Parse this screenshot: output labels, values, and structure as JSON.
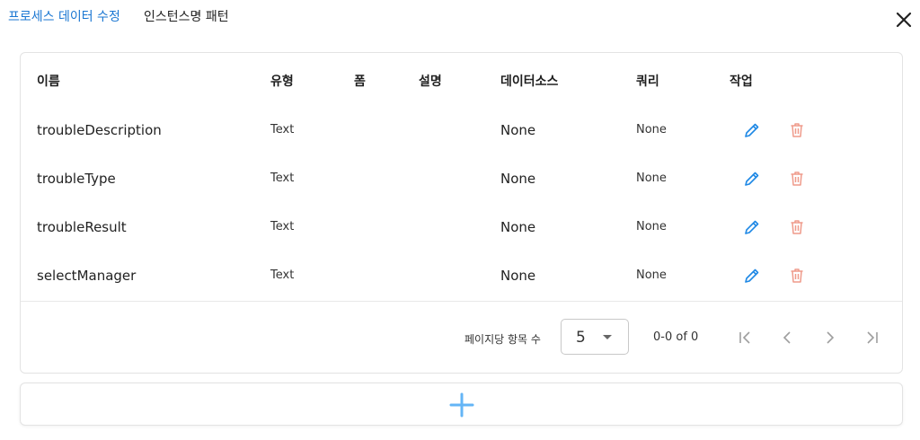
{
  "tabs": {
    "active": "프로세스 데이터 수정",
    "inactive": "인스턴스명 패턴"
  },
  "table": {
    "headers": {
      "name": "이름",
      "type": "유형",
      "form": "폼",
      "desc": "설명",
      "datasource": "데이터소스",
      "query": "쿼리",
      "actions": "작업"
    },
    "rows": [
      {
        "name": "troubleDescription",
        "type": "Text",
        "datasource": "None",
        "query": "None"
      },
      {
        "name": "troubleType",
        "type": "Text",
        "datasource": "None",
        "query": "None"
      },
      {
        "name": "troubleResult",
        "type": "Text",
        "datasource": "None",
        "query": "None"
      },
      {
        "name": "selectManager",
        "type": "Text",
        "datasource": "None",
        "query": "None"
      }
    ]
  },
  "pagination": {
    "rows_per_page_label": "페이지당 항목 수",
    "rows_per_page_value": "5",
    "range_text": "0-0 of 0"
  },
  "colors": {
    "accent": "#1976d2",
    "edit": "#1e88e5",
    "delete": "#ef9a8a",
    "add": "#64b5f6"
  },
  "icons": {
    "close": "close-icon",
    "edit": "pencil-icon",
    "delete": "trash-icon",
    "dropdown": "caret-down-icon",
    "add": "plus-icon",
    "first": "first-page-icon",
    "prev": "chevron-left-icon",
    "next": "chevron-right-icon",
    "last": "last-page-icon"
  }
}
